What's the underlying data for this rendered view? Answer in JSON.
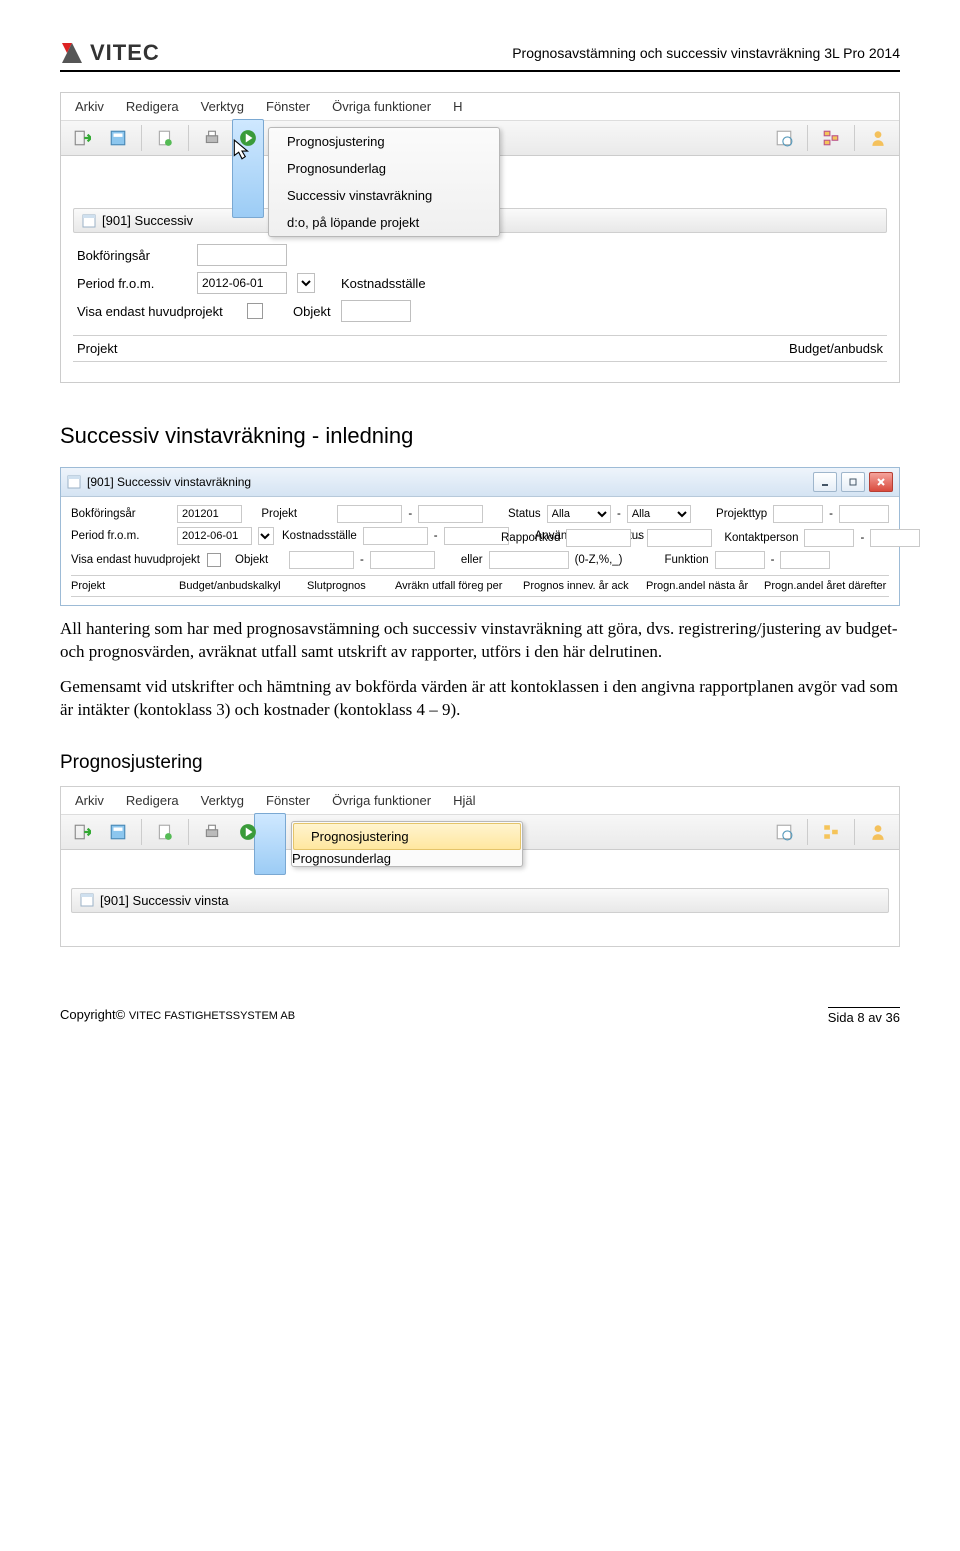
{
  "header": {
    "title": "Prognosavstämning och successiv vinstavräkning 3L Pro 2014",
    "logo_text": "VITEC"
  },
  "ss1": {
    "menu": [
      "Arkiv",
      "Redigera",
      "Verktyg",
      "Fönster",
      "Övriga funktioner",
      "H"
    ],
    "dropdown": [
      "Prognosjustering",
      "Prognosunderlag",
      "Successiv vinstavräkning",
      "d:o, på löpande projekt"
    ],
    "wintitle": "[901]  Successiv",
    "labels": {
      "bokforingsar": "Bokföringsår",
      "period": "Period fr.o.m.",
      "visa": "Visa endast huvudprojekt",
      "kostnadsstalle": "Kostnadsställe",
      "objekt": "Objekt",
      "projekt": "Projekt",
      "budget": "Budget/anbudsk"
    },
    "values": {
      "period": "2012-06-01"
    }
  },
  "section1_title": "Successiv vinstavräkning - inledning",
  "ss2": {
    "wintitle": "[901]  Successiv vinstavräkning",
    "labels": {
      "bokforingsar": "Bokföringsår",
      "projekt": "Projekt",
      "status": "Status",
      "alla": "Alla",
      "projekttyp": "Projekttyp",
      "period": "Period fr.o.m.",
      "kostnadsstalle": "Kostnadsställe",
      "rapportkod": "Rapportkod",
      "anvand": "Använd aktuell status",
      "kontaktperson": "Kontaktperson",
      "visa": "Visa endast huvudprojekt",
      "objekt": "Objekt",
      "eller": "eller",
      "regex": "(0-Z,%,_)",
      "funktion": "Funktion"
    },
    "values": {
      "bokforingsar": "201201",
      "period": "2012-06-01"
    },
    "cols": [
      "Projekt",
      "Budget/anbudskalkyl",
      "Slutprognos",
      "Avräkn utfall föreg per",
      "Prognos innev. år ack",
      "Progn.andel nästa år",
      "Progn.andel året därefter"
    ]
  },
  "body": {
    "p1": "All hantering som har med prognosavstämning och successiv vinstavräkning att göra, dvs. registrering/justering av budget- och prognosvärden, avräknat utfall samt utskrift av rapporter, utförs i den här delrutinen.",
    "p2": "Gemensamt vid utskrifter och hämtning av bokförda värden är att kontoklassen i den angivna rapportplanen avgör vad som är intäkter (kontoklass 3) och kostnader (kontoklass 4 – 9)."
  },
  "section2_title": "Prognosjustering",
  "ss3": {
    "menu": [
      "Arkiv",
      "Redigera",
      "Verktyg",
      "Fönster",
      "Övriga funktioner",
      "Hjäl"
    ],
    "dropdown": [
      "Prognosjustering",
      "Prognosunderlag"
    ],
    "wintitle": "[901]  Successiv vinsta"
  },
  "footer": {
    "copyright": "Copyright© ",
    "company": "Vitec Fastighetssystem AB",
    "page": "Sida 8 av 36"
  }
}
